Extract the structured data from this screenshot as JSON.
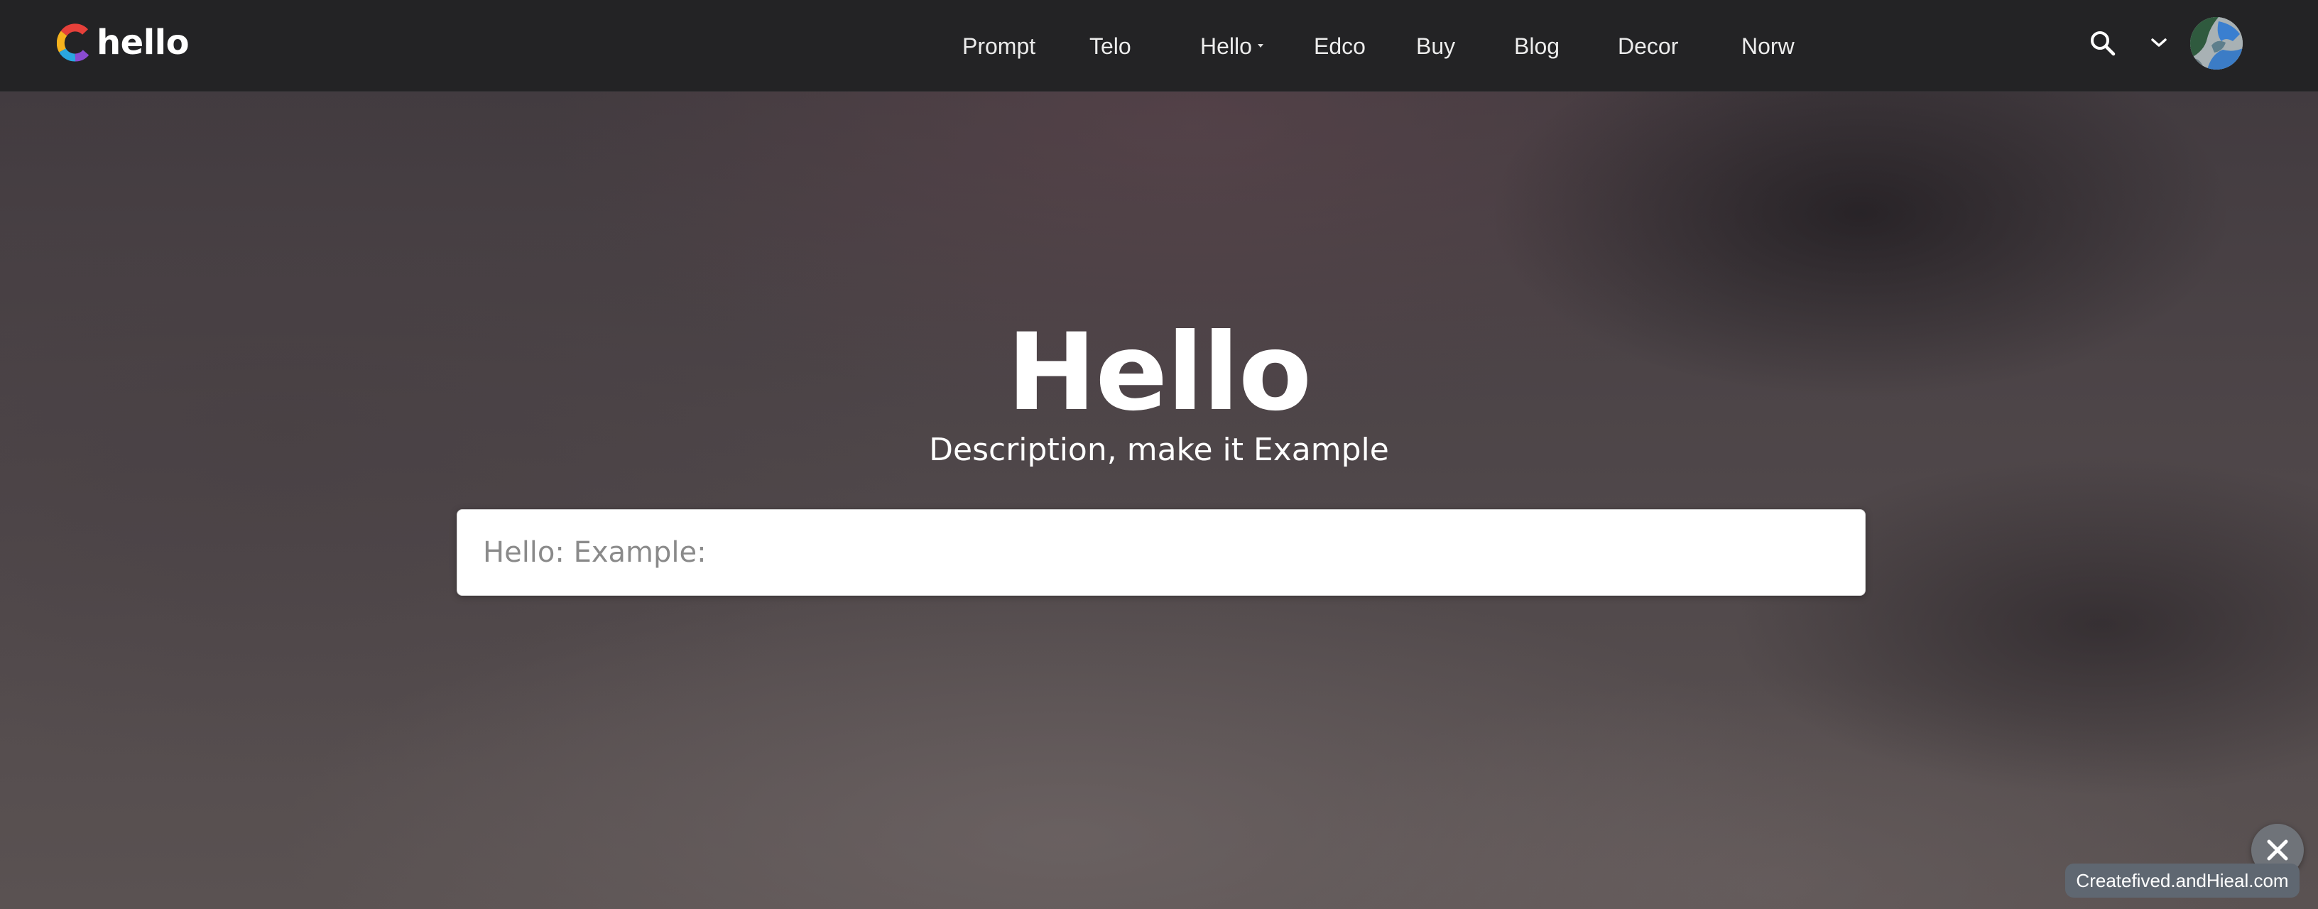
{
  "brand": {
    "name": "hello",
    "logo_icon": "c-logo-icon",
    "colors": [
      "#e6403a",
      "#f5b21d",
      "#2aa7e0",
      "#8a4bd1"
    ]
  },
  "nav": {
    "items": [
      {
        "label": "Prompt"
      },
      {
        "label": "Telo"
      },
      {
        "label": "Hello",
        "has_dropdown": true
      },
      {
        "label": "Edco"
      },
      {
        "label": "Buy"
      },
      {
        "label": "Blog"
      },
      {
        "label": "Decor"
      },
      {
        "label": "Norw"
      }
    ],
    "search_icon": "search-icon",
    "dropdown_icon": "chevron-down-icon"
  },
  "hero": {
    "title": "Hello",
    "subtitle": "Description, make it Example",
    "search_placeholder": "Hello: Example:"
  },
  "footer": {
    "close_icon": "close-icon",
    "badge_text": "Createfived.andHieal.com"
  },
  "theme": {
    "navbar_bg": "#232325",
    "badge_bg": "#5f6771",
    "fab_bg": "#6f7379"
  }
}
